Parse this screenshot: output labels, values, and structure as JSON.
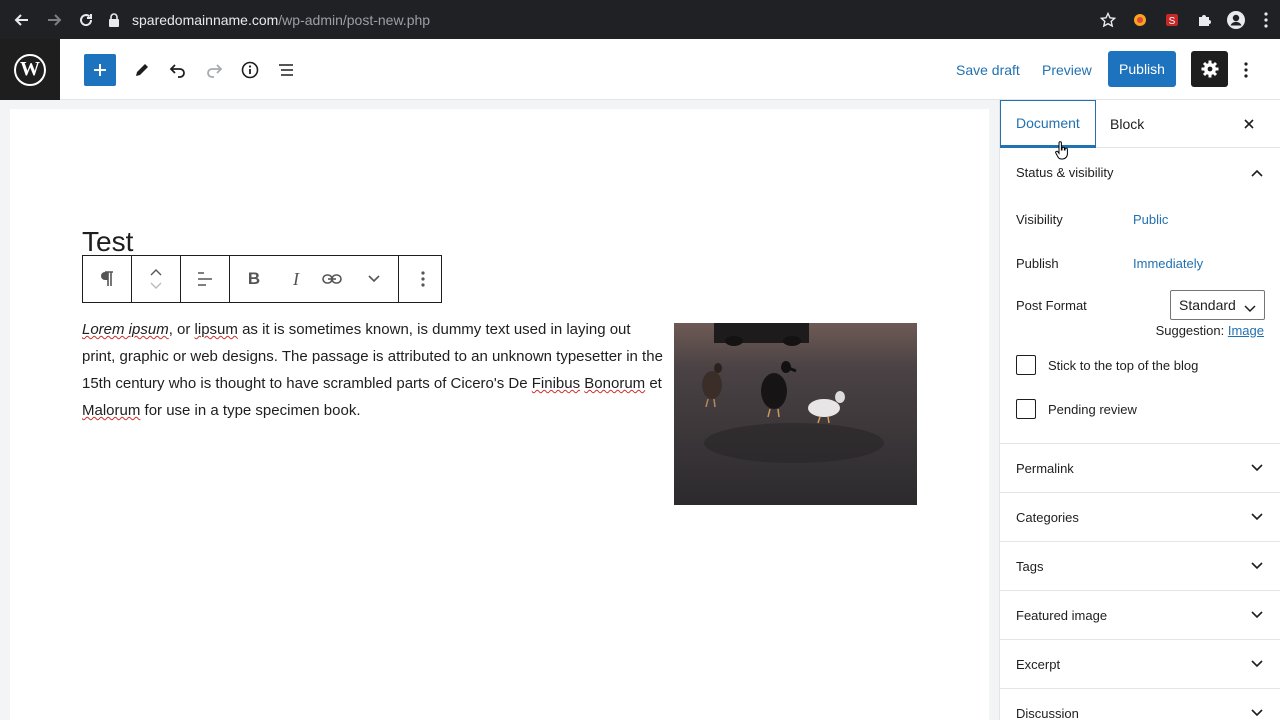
{
  "browser": {
    "url_host": "sparedomainname.com",
    "url_path": "/wp-admin/post-new.php"
  },
  "header": {
    "save_draft": "Save draft",
    "preview": "Preview",
    "publish": "Publish",
    "accent": "#1e73be"
  },
  "post": {
    "title": "Test",
    "paragraph": {
      "w1": "Lorem ipsum",
      "t1": ", or ",
      "w2": "lipsum",
      "t2": " as it is sometimes known, is dummy text used in laying out print, graphic or web designs. The passage is attributed to an unknown typesetter in the 15th century who is thought to have scrambled parts of Cicero's De ",
      "w3": "Finibus",
      "t3": " ",
      "w4": "Bonorum",
      "t4": " et ",
      "w5": "Malorum",
      "t5": " for use in a type specimen book."
    }
  },
  "sidebar": {
    "tabs": [
      "Document",
      "Block"
    ],
    "status": {
      "heading": "Status & visibility",
      "visibility_label": "Visibility",
      "visibility_value": "Public",
      "publish_label": "Publish",
      "publish_value": "Immediately",
      "format_label": "Post Format",
      "format_value": "Standard",
      "suggestion_label": "Suggestion:",
      "suggestion_value": "Image",
      "sticky_label": "Stick to the top of the blog",
      "pending_label": "Pending review"
    },
    "panels": [
      "Permalink",
      "Categories",
      "Tags",
      "Featured image",
      "Excerpt",
      "Discussion"
    ]
  }
}
